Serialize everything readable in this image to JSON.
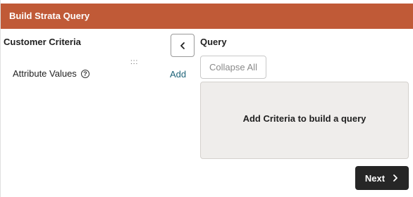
{
  "header": {
    "title": "Build Strata Query"
  },
  "customer_criteria": {
    "title": "Customer Criteria",
    "items": [
      {
        "label": "Attribute Values",
        "help_icon": "?",
        "add_label": "Add"
      }
    ],
    "drag_handle": ":::"
  },
  "query": {
    "title": "Query",
    "collapse_all_label": "Collapse All",
    "empty_message": "Add Criteria to build a query"
  },
  "footer": {
    "next_label": "Next"
  },
  "colors": {
    "header_bg": "#c05a37",
    "link": "#1e6378",
    "next_bg": "#262626",
    "query_area_bg": "#efedeb"
  },
  "icons": {
    "side_toggle": "chevron-left-icon",
    "next": "chevron-right-icon",
    "help": "help-circle-icon"
  }
}
